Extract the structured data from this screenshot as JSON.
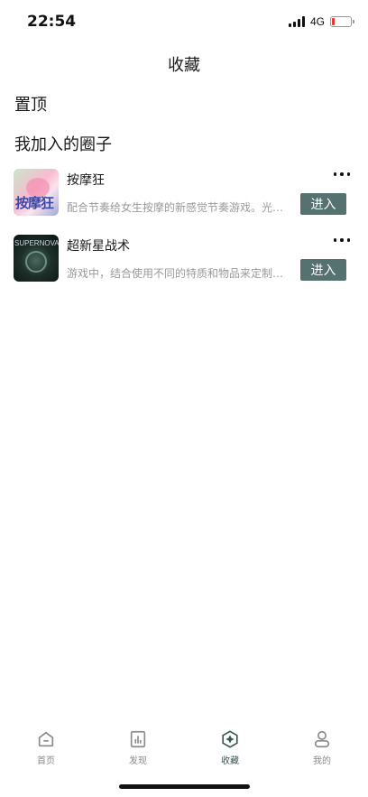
{
  "status": {
    "time": "22:54",
    "network": "4G",
    "battery_level": 0.15,
    "battery_color": "#e53935"
  },
  "page": {
    "title": "收藏"
  },
  "sections": {
    "pinned": "置顶",
    "joined_circles": "我加入的圈子"
  },
  "circles": [
    {
      "name": "按摩狂",
      "description": "配合节奏给女生按摩的新感觉节奏游戏。光…",
      "enter_label": "进入",
      "thumb_text": "按摩狂"
    },
    {
      "name": "超新星战术",
      "description": "游戏中，结合使用不同的特质和物品来定制…",
      "enter_label": "进入",
      "thumb_text": "SUPERNOVA"
    }
  ],
  "tabs": [
    {
      "label": "首页",
      "icon": "home-icon",
      "active": false
    },
    {
      "label": "发现",
      "icon": "discover-icon",
      "active": false
    },
    {
      "label": "收藏",
      "icon": "favorites-icon",
      "active": true
    },
    {
      "label": "我的",
      "icon": "profile-icon",
      "active": false
    }
  ],
  "colors": {
    "accent": "#557170",
    "active_tab": "#3b5553",
    "inactive_tab": "#8a8a8a"
  }
}
